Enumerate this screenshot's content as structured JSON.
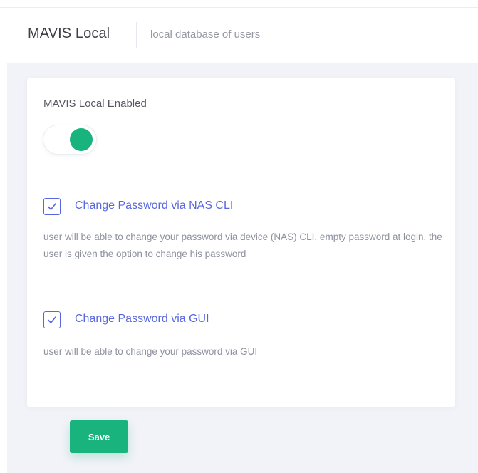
{
  "header": {
    "title": "MAVIS Local",
    "description": "local database of users"
  },
  "settings": {
    "enabled_label": "MAVIS Local Enabled",
    "enabled": true,
    "options": [
      {
        "label": "Change Password via NAS CLI",
        "checked": true,
        "help": "user will be able to change your password via device (NAS) CLI, empty password at login, the user is given the option to change his password"
      },
      {
        "label": "Change Password via GUI",
        "checked": true,
        "help": "user will be able to change your password via GUI"
      }
    ]
  },
  "actions": {
    "save_label": "Save"
  },
  "colors": {
    "accent": "#5867dd",
    "success": "#19b47e",
    "page_background": "#f2f3f8"
  },
  "icons": {
    "checkbox_mark": "check-icon"
  }
}
